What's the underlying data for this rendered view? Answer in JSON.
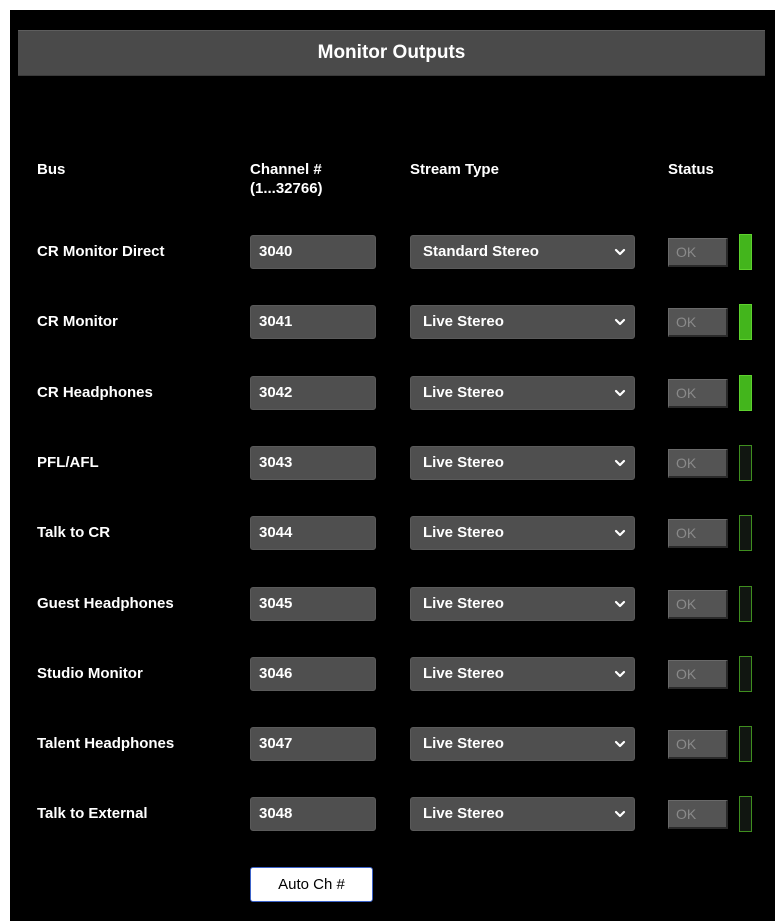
{
  "panel": {
    "title": "Monitor Outputs"
  },
  "headers": {
    "bus": "Bus",
    "channel_line1": "Channel #",
    "channel_line2": "(1...32766)",
    "stream_type": "Stream Type",
    "status": "Status"
  },
  "rows": [
    {
      "bus": "CR Monitor Direct",
      "channel": "3040",
      "stream": "Standard Stereo",
      "status": "OK",
      "active": true
    },
    {
      "bus": "CR Monitor",
      "channel": "3041",
      "stream": "Live Stereo",
      "status": "OK",
      "active": true
    },
    {
      "bus": "CR Headphones",
      "channel": "3042",
      "stream": "Live Stereo",
      "status": "OK",
      "active": true
    },
    {
      "bus": "PFL/AFL",
      "channel": "3043",
      "stream": "Live Stereo",
      "status": "OK",
      "active": false
    },
    {
      "bus": "Talk to CR",
      "channel": "3044",
      "stream": "Live Stereo",
      "status": "OK",
      "active": false
    },
    {
      "bus": "Guest Headphones",
      "channel": "3045",
      "stream": "Live Stereo",
      "status": "OK",
      "active": false
    },
    {
      "bus": "Studio Monitor",
      "channel": "3046",
      "stream": "Live Stereo",
      "status": "OK",
      "active": false
    },
    {
      "bus": "Talent Headphones",
      "channel": "3047",
      "stream": "Live Stereo",
      "status": "OK",
      "active": false
    },
    {
      "bus": "Talk to External",
      "channel": "3048",
      "stream": "Live Stereo",
      "status": "OK",
      "active": false
    }
  ],
  "actions": {
    "auto_channel_label": "Auto Ch #"
  },
  "icons": {
    "dropdown": "chevron-down-icon"
  },
  "colors": {
    "led_on": "#43b51c",
    "led_off_border": "#3f8e1f",
    "auto_button_border": "#3c63c9"
  }
}
